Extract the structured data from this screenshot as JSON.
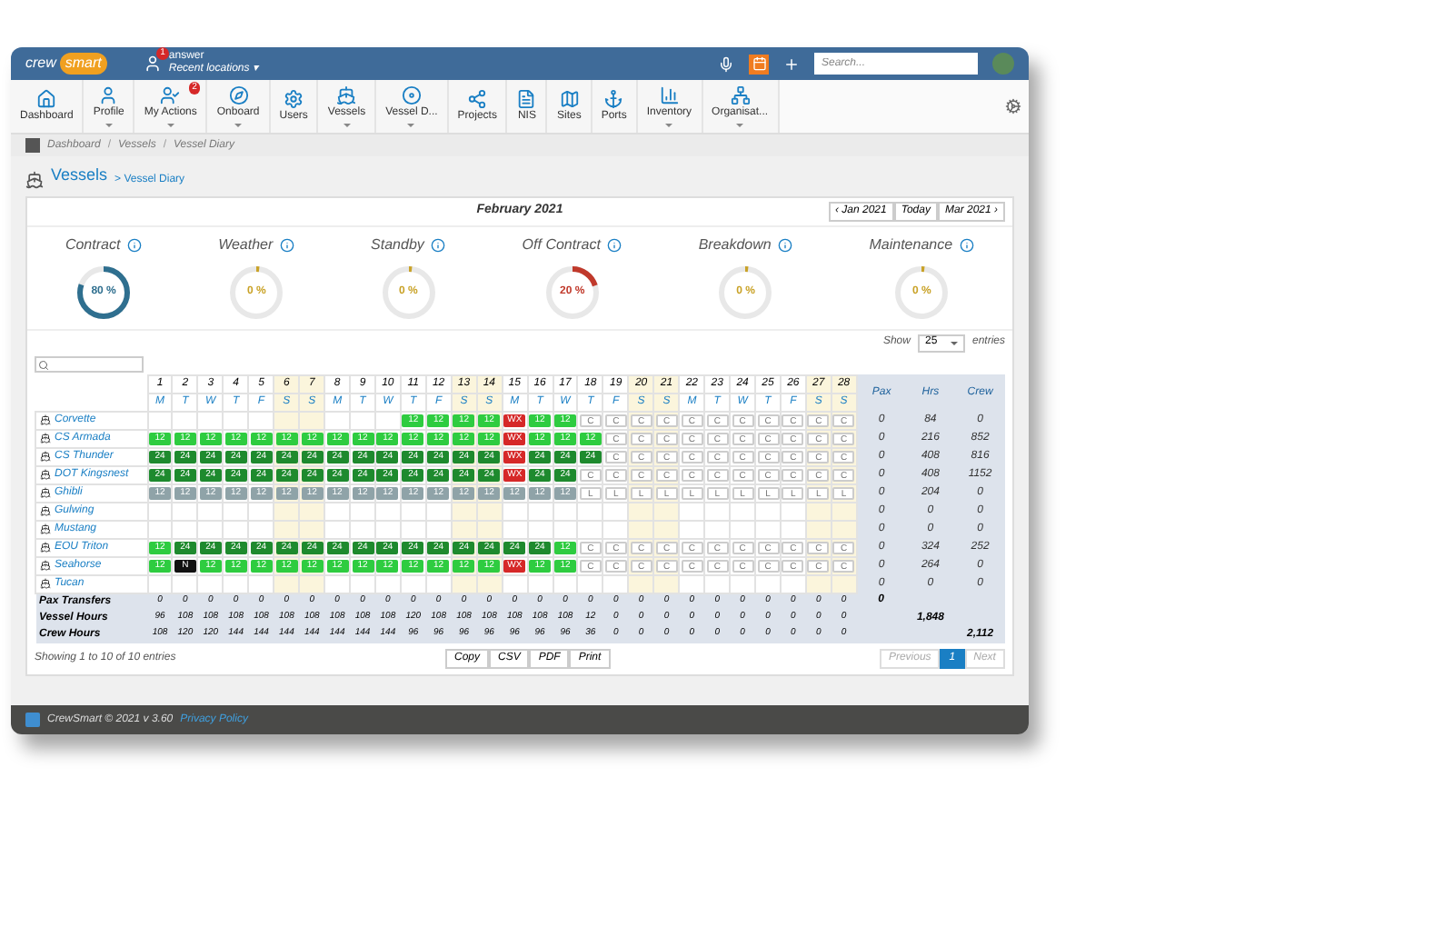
{
  "header": {
    "logo": [
      "crew",
      "smart"
    ],
    "user": "answer",
    "user_badge": "1",
    "recent": "Recent locations ▾",
    "search": {
      "placeholder": "Search..."
    }
  },
  "nav": [
    {
      "label": "Dashboard",
      "has_menu": false
    },
    {
      "label": "Profile",
      "has_menu": true
    },
    {
      "label": "My Actions",
      "has_menu": true,
      "badge": "2"
    },
    {
      "label": "Onboard",
      "has_menu": true
    },
    {
      "label": "Users",
      "has_menu": false
    },
    {
      "label": "Vessels",
      "has_menu": true
    },
    {
      "label": "Vessel D...",
      "has_menu": true
    },
    {
      "label": "Projects",
      "has_menu": false
    },
    {
      "label": "NIS",
      "has_menu": false
    },
    {
      "label": "Sites",
      "has_menu": false
    },
    {
      "label": "Ports",
      "has_menu": false
    },
    {
      "label": "Inventory",
      "has_menu": true
    },
    {
      "label": "Organisat...",
      "has_menu": true
    }
  ],
  "breadcrumb": [
    {
      "kind": "link",
      "text": "Dashboard"
    },
    {
      "kind": "separator",
      "text": "/"
    },
    {
      "kind": "link",
      "text": "Vessels"
    },
    {
      "kind": "separator",
      "text": "/"
    },
    {
      "kind": "link",
      "text": "Vessel Diary"
    }
  ],
  "page_title": {
    "main": "Vessels",
    "sub": "> Vessel Diary"
  },
  "month": {
    "label": "February 2021",
    "prev": "‹ Jan 2021",
    "today": "Today",
    "next": "Mar 2021 ›"
  },
  "kpis": [
    {
      "label": "Contract",
      "reading": "80 %",
      "level": 0.8,
      "color": "#2f6f8f"
    },
    {
      "label": "Weather",
      "reading": "0 %",
      "level": 0.02,
      "color": "#c9a227"
    },
    {
      "label": "Standby",
      "reading": "0 %",
      "level": 0.02,
      "color": "#c9a227"
    },
    {
      "label": "Off Contract",
      "reading": "20 %",
      "level": 0.2,
      "color": "#c0392b"
    },
    {
      "label": "Breakdown",
      "reading": "0 %",
      "level": 0.02,
      "color": "#c9a227"
    },
    {
      "label": "Maintenance",
      "reading": "0 %",
      "level": 0.02,
      "color": "#c9a227"
    }
  ],
  "show": {
    "label": "Show",
    "value": "25",
    "suffix": "entries"
  },
  "table": {
    "days": [
      {
        "day": "1",
        "weekday": "M",
        "weekend": false
      },
      {
        "day": "2",
        "weekday": "T",
        "weekend": false
      },
      {
        "day": "3",
        "weekday": "W",
        "weekend": false
      },
      {
        "day": "4",
        "weekday": "T",
        "weekend": false
      },
      {
        "day": "5",
        "weekday": "F",
        "weekend": false
      },
      {
        "day": "6",
        "weekday": "S",
        "weekend": true
      },
      {
        "day": "7",
        "weekday": "S",
        "weekend": true
      },
      {
        "day": "8",
        "weekday": "M",
        "weekend": false
      },
      {
        "day": "9",
        "weekday": "T",
        "weekend": false
      },
      {
        "day": "10",
        "weekday": "W",
        "weekend": false
      },
      {
        "day": "11",
        "weekday": "T",
        "weekend": false
      },
      {
        "day": "12",
        "weekday": "F",
        "weekend": false
      },
      {
        "day": "13",
        "weekday": "S",
        "weekend": true
      },
      {
        "day": "14",
        "weekday": "S",
        "weekend": true
      },
      {
        "day": "15",
        "weekday": "M",
        "weekend": false
      },
      {
        "day": "16",
        "weekday": "T",
        "weekend": false
      },
      {
        "day": "17",
        "weekday": "W",
        "weekend": false
      },
      {
        "day": "18",
        "weekday": "T",
        "weekend": false
      },
      {
        "day": "19",
        "weekday": "F",
        "weekend": false
      },
      {
        "day": "20",
        "weekday": "S",
        "weekend": true
      },
      {
        "day": "21",
        "weekday": "S",
        "weekend": true
      },
      {
        "day": "22",
        "weekday": "M",
        "weekend": false
      },
      {
        "day": "23",
        "weekday": "T",
        "weekend": false
      },
      {
        "day": "24",
        "weekday": "W",
        "weekend": false
      },
      {
        "day": "25",
        "weekday": "T",
        "weekend": false
      },
      {
        "day": "26",
        "weekday": "F",
        "weekend": false
      },
      {
        "day": "27",
        "weekday": "S",
        "weekend": true
      },
      {
        "day": "28",
        "weekday": "S",
        "weekend": true
      }
    ],
    "total_columns": [
      "Pax",
      "Hrs",
      "Crew"
    ],
    "rows": [
      {
        "vessel": "Corvette",
        "totals": [
          "0",
          "84",
          "0"
        ],
        "cells": [
          {
            "kind": "empty"
          },
          {
            "kind": "empty"
          },
          {
            "kind": "empty"
          },
          {
            "kind": "empty"
          },
          {
            "kind": "empty"
          },
          {
            "kind": "empty"
          },
          {
            "kind": "empty"
          },
          {
            "kind": "empty"
          },
          {
            "kind": "empty"
          },
          {
            "kind": "empty"
          },
          {
            "kind": "light",
            "text": "12"
          },
          {
            "kind": "light",
            "text": "12"
          },
          {
            "kind": "light",
            "text": "12"
          },
          {
            "kind": "light",
            "text": "12"
          },
          {
            "kind": "red",
            "text": "WX"
          },
          {
            "kind": "light",
            "text": "12"
          },
          {
            "kind": "light",
            "text": "12"
          },
          {
            "kind": "contract",
            "text": "C"
          },
          {
            "kind": "contract",
            "text": "C"
          },
          {
            "kind": "contract",
            "text": "C"
          },
          {
            "kind": "contract",
            "text": "C"
          },
          {
            "kind": "contract",
            "text": "C"
          },
          {
            "kind": "contract",
            "text": "C"
          },
          {
            "kind": "contract",
            "text": "C"
          },
          {
            "kind": "contract",
            "text": "C"
          },
          {
            "kind": "contract",
            "text": "C"
          },
          {
            "kind": "contract",
            "text": "C"
          },
          {
            "kind": "contract",
            "text": "C"
          }
        ]
      },
      {
        "vessel": "CS Armada",
        "totals": [
          "0",
          "216",
          "852"
        ],
        "cells": [
          {
            "kind": "light",
            "text": "12"
          },
          {
            "kind": "light",
            "text": "12"
          },
          {
            "kind": "light",
            "text": "12"
          },
          {
            "kind": "light",
            "text": "12"
          },
          {
            "kind": "light",
            "text": "12"
          },
          {
            "kind": "light",
            "text": "12"
          },
          {
            "kind": "light",
            "text": "12"
          },
          {
            "kind": "light",
            "text": "12"
          },
          {
            "kind": "light",
            "text": "12"
          },
          {
            "kind": "light",
            "text": "12"
          },
          {
            "kind": "light",
            "text": "12"
          },
          {
            "kind": "light",
            "text": "12"
          },
          {
            "kind": "light",
            "text": "12"
          },
          {
            "kind": "light",
            "text": "12"
          },
          {
            "kind": "red",
            "text": "WX"
          },
          {
            "kind": "light",
            "text": "12"
          },
          {
            "kind": "light",
            "text": "12"
          },
          {
            "kind": "light",
            "text": "12"
          },
          {
            "kind": "contract",
            "text": "C"
          },
          {
            "kind": "contract",
            "text": "C"
          },
          {
            "kind": "contract",
            "text": "C"
          },
          {
            "kind": "contract",
            "text": "C"
          },
          {
            "kind": "contract",
            "text": "C"
          },
          {
            "kind": "contract",
            "text": "C"
          },
          {
            "kind": "contract",
            "text": "C"
          },
          {
            "kind": "contract",
            "text": "C"
          },
          {
            "kind": "contract",
            "text": "C"
          },
          {
            "kind": "contract",
            "text": "C"
          }
        ]
      },
      {
        "vessel": "CS Thunder",
        "totals": [
          "0",
          "408",
          "816"
        ],
        "cells": [
          {
            "kind": "dark",
            "text": "24"
          },
          {
            "kind": "dark",
            "text": "24"
          },
          {
            "kind": "dark",
            "text": "24"
          },
          {
            "kind": "dark",
            "text": "24"
          },
          {
            "kind": "dark",
            "text": "24"
          },
          {
            "kind": "dark",
            "text": "24"
          },
          {
            "kind": "dark",
            "text": "24"
          },
          {
            "kind": "dark",
            "text": "24"
          },
          {
            "kind": "dark",
            "text": "24"
          },
          {
            "kind": "dark",
            "text": "24"
          },
          {
            "kind": "dark",
            "text": "24"
          },
          {
            "kind": "dark",
            "text": "24"
          },
          {
            "kind": "dark",
            "text": "24"
          },
          {
            "kind": "dark",
            "text": "24"
          },
          {
            "kind": "red",
            "text": "WX"
          },
          {
            "kind": "dark",
            "text": "24"
          },
          {
            "kind": "dark",
            "text": "24"
          },
          {
            "kind": "dark",
            "text": "24"
          },
          {
            "kind": "contract",
            "text": "C"
          },
          {
            "kind": "contract",
            "text": "C"
          },
          {
            "kind": "contract",
            "text": "C"
          },
          {
            "kind": "contract",
            "text": "C"
          },
          {
            "kind": "contract",
            "text": "C"
          },
          {
            "kind": "contract",
            "text": "C"
          },
          {
            "kind": "contract",
            "text": "C"
          },
          {
            "kind": "contract",
            "text": "C"
          },
          {
            "kind": "contract",
            "text": "C"
          },
          {
            "kind": "contract",
            "text": "C"
          }
        ]
      },
      {
        "vessel": "DOT Kingsnest",
        "totals": [
          "0",
          "408",
          "1152"
        ],
        "cells": [
          {
            "kind": "dark",
            "text": "24"
          },
          {
            "kind": "dark",
            "text": "24"
          },
          {
            "kind": "dark",
            "text": "24"
          },
          {
            "kind": "dark",
            "text": "24"
          },
          {
            "kind": "dark",
            "text": "24"
          },
          {
            "kind": "dark",
            "text": "24"
          },
          {
            "kind": "dark",
            "text": "24"
          },
          {
            "kind": "dark",
            "text": "24"
          },
          {
            "kind": "dark",
            "text": "24"
          },
          {
            "kind": "dark",
            "text": "24"
          },
          {
            "kind": "dark",
            "text": "24"
          },
          {
            "kind": "dark",
            "text": "24"
          },
          {
            "kind": "dark",
            "text": "24"
          },
          {
            "kind": "dark",
            "text": "24"
          },
          {
            "kind": "red",
            "text": "WX"
          },
          {
            "kind": "dark",
            "text": "24"
          },
          {
            "kind": "dark",
            "text": "24"
          },
          {
            "kind": "contract",
            "text": "C"
          },
          {
            "kind": "contract",
            "text": "C"
          },
          {
            "kind": "contract",
            "text": "C"
          },
          {
            "kind": "contract",
            "text": "C"
          },
          {
            "kind": "contract",
            "text": "C"
          },
          {
            "kind": "contract",
            "text": "C"
          },
          {
            "kind": "contract",
            "text": "C"
          },
          {
            "kind": "contract",
            "text": "C"
          },
          {
            "kind": "contract",
            "text": "C"
          },
          {
            "kind": "contract",
            "text": "C"
          },
          {
            "kind": "contract",
            "text": "C"
          }
        ]
      },
      {
        "vessel": "Ghibli",
        "totals": [
          "0",
          "204",
          "0"
        ],
        "cells": [
          {
            "kind": "grey",
            "text": "12"
          },
          {
            "kind": "grey",
            "text": "12"
          },
          {
            "kind": "grey",
            "text": "12"
          },
          {
            "kind": "grey",
            "text": "12"
          },
          {
            "kind": "grey",
            "text": "12"
          },
          {
            "kind": "grey",
            "text": "12"
          },
          {
            "kind": "grey",
            "text": "12"
          },
          {
            "kind": "grey",
            "text": "12"
          },
          {
            "kind": "grey",
            "text": "12"
          },
          {
            "kind": "grey",
            "text": "12"
          },
          {
            "kind": "grey",
            "text": "12"
          },
          {
            "kind": "grey",
            "text": "12"
          },
          {
            "kind": "grey",
            "text": "12"
          },
          {
            "kind": "grey",
            "text": "12"
          },
          {
            "kind": "grey",
            "text": "12"
          },
          {
            "kind": "grey",
            "text": "12"
          },
          {
            "kind": "grey",
            "text": "12"
          },
          {
            "kind": "contract",
            "text": "L"
          },
          {
            "kind": "contract",
            "text": "L"
          },
          {
            "kind": "contract",
            "text": "L"
          },
          {
            "kind": "contract",
            "text": "L"
          },
          {
            "kind": "contract",
            "text": "L"
          },
          {
            "kind": "contract",
            "text": "L"
          },
          {
            "kind": "contract",
            "text": "L"
          },
          {
            "kind": "contract",
            "text": "L"
          },
          {
            "kind": "contract",
            "text": "L"
          },
          {
            "kind": "contract",
            "text": "L"
          },
          {
            "kind": "contract",
            "text": "L"
          }
        ]
      },
      {
        "vessel": "Gulwing",
        "totals": [
          "0",
          "0",
          "0"
        ],
        "cells": [
          {
            "kind": "empty"
          },
          {
            "kind": "empty"
          },
          {
            "kind": "empty"
          },
          {
            "kind": "empty"
          },
          {
            "kind": "empty"
          },
          {
            "kind": "empty"
          },
          {
            "kind": "empty"
          },
          {
            "kind": "empty"
          },
          {
            "kind": "empty"
          },
          {
            "kind": "empty"
          },
          {
            "kind": "empty"
          },
          {
            "kind": "empty"
          },
          {
            "kind": "empty"
          },
          {
            "kind": "empty"
          },
          {
            "kind": "empty"
          },
          {
            "kind": "empty"
          },
          {
            "kind": "empty"
          },
          {
            "kind": "empty"
          },
          {
            "kind": "empty"
          },
          {
            "kind": "empty"
          },
          {
            "kind": "empty"
          },
          {
            "kind": "empty"
          },
          {
            "kind": "empty"
          },
          {
            "kind": "empty"
          },
          {
            "kind": "empty"
          },
          {
            "kind": "empty"
          },
          {
            "kind": "empty"
          },
          {
            "kind": "empty"
          }
        ]
      },
      {
        "vessel": "Mustang",
        "totals": [
          "0",
          "0",
          "0"
        ],
        "cells": [
          {
            "kind": "empty"
          },
          {
            "kind": "empty"
          },
          {
            "kind": "empty"
          },
          {
            "kind": "empty"
          },
          {
            "kind": "empty"
          },
          {
            "kind": "empty"
          },
          {
            "kind": "empty"
          },
          {
            "kind": "empty"
          },
          {
            "kind": "empty"
          },
          {
            "kind": "empty"
          },
          {
            "kind": "empty"
          },
          {
            "kind": "empty"
          },
          {
            "kind": "empty"
          },
          {
            "kind": "empty"
          },
          {
            "kind": "empty"
          },
          {
            "kind": "empty"
          },
          {
            "kind": "empty"
          },
          {
            "kind": "empty"
          },
          {
            "kind": "empty"
          },
          {
            "kind": "empty"
          },
          {
            "kind": "empty"
          },
          {
            "kind": "empty"
          },
          {
            "kind": "empty"
          },
          {
            "kind": "empty"
          },
          {
            "kind": "empty"
          },
          {
            "kind": "empty"
          },
          {
            "kind": "empty"
          },
          {
            "kind": "empty"
          }
        ]
      },
      {
        "vessel": "EOU Triton",
        "totals": [
          "0",
          "324",
          "252"
        ],
        "cells": [
          {
            "kind": "light",
            "text": "12"
          },
          {
            "kind": "dark",
            "text": "24"
          },
          {
            "kind": "dark",
            "text": "24"
          },
          {
            "kind": "dark",
            "text": "24"
          },
          {
            "kind": "dark",
            "text": "24"
          },
          {
            "kind": "dark",
            "text": "24"
          },
          {
            "kind": "dark",
            "text": "24"
          },
          {
            "kind": "dark",
            "text": "24"
          },
          {
            "kind": "dark",
            "text": "24"
          },
          {
            "kind": "dark",
            "text": "24"
          },
          {
            "kind": "dark",
            "text": "24"
          },
          {
            "kind": "dark",
            "text": "24"
          },
          {
            "kind": "dark",
            "text": "24"
          },
          {
            "kind": "dark",
            "text": "24"
          },
          {
            "kind": "dark",
            "text": "24"
          },
          {
            "kind": "dark",
            "text": "24"
          },
          {
            "kind": "light",
            "text": "12"
          },
          {
            "kind": "contract",
            "text": "C"
          },
          {
            "kind": "contract",
            "text": "C"
          },
          {
            "kind": "contract",
            "text": "C"
          },
          {
            "kind": "contract",
            "text": "C"
          },
          {
            "kind": "contract",
            "text": "C"
          },
          {
            "kind": "contract",
            "text": "C"
          },
          {
            "kind": "contract",
            "text": "C"
          },
          {
            "kind": "contract",
            "text": "C"
          },
          {
            "kind": "contract",
            "text": "C"
          },
          {
            "kind": "contract",
            "text": "C"
          },
          {
            "kind": "contract",
            "text": "C"
          }
        ]
      },
      {
        "vessel": "Seahorse",
        "totals": [
          "0",
          "264",
          "0"
        ],
        "cells": [
          {
            "kind": "light",
            "text": "12"
          },
          {
            "kind": "black",
            "text": "N"
          },
          {
            "kind": "light",
            "text": "12"
          },
          {
            "kind": "light",
            "text": "12"
          },
          {
            "kind": "light",
            "text": "12"
          },
          {
            "kind": "light",
            "text": "12"
          },
          {
            "kind": "light",
            "text": "12"
          },
          {
            "kind": "light",
            "text": "12"
          },
          {
            "kind": "light",
            "text": "12"
          },
          {
            "kind": "light",
            "text": "12"
          },
          {
            "kind": "light",
            "text": "12"
          },
          {
            "kind": "light",
            "text": "12"
          },
          {
            "kind": "light",
            "text": "12"
          },
          {
            "kind": "light",
            "text": "12"
          },
          {
            "kind": "red",
            "text": "WX"
          },
          {
            "kind": "light",
            "text": "12"
          },
          {
            "kind": "light",
            "text": "12"
          },
          {
            "kind": "contract",
            "text": "C"
          },
          {
            "kind": "contract",
            "text": "C"
          },
          {
            "kind": "contract",
            "text": "C"
          },
          {
            "kind": "contract",
            "text": "C"
          },
          {
            "kind": "contract",
            "text": "C"
          },
          {
            "kind": "contract",
            "text": "C"
          },
          {
            "kind": "contract",
            "text": "C"
          },
          {
            "kind": "contract",
            "text": "C"
          },
          {
            "kind": "contract",
            "text": "C"
          },
          {
            "kind": "contract",
            "text": "C"
          },
          {
            "kind": "contract",
            "text": "C"
          }
        ]
      },
      {
        "vessel": "Tucan",
        "totals": [
          "0",
          "0",
          "0"
        ],
        "cells": [
          {
            "kind": "empty"
          },
          {
            "kind": "empty"
          },
          {
            "kind": "empty"
          },
          {
            "kind": "empty"
          },
          {
            "kind": "empty"
          },
          {
            "kind": "empty"
          },
          {
            "kind": "empty"
          },
          {
            "kind": "empty"
          },
          {
            "kind": "empty"
          },
          {
            "kind": "empty"
          },
          {
            "kind": "empty"
          },
          {
            "kind": "empty"
          },
          {
            "kind": "empty"
          },
          {
            "kind": "empty"
          },
          {
            "kind": "empty"
          },
          {
            "kind": "empty"
          },
          {
            "kind": "empty"
          },
          {
            "kind": "empty"
          },
          {
            "kind": "empty"
          },
          {
            "kind": "empty"
          },
          {
            "kind": "empty"
          },
          {
            "kind": "empty"
          },
          {
            "kind": "empty"
          },
          {
            "kind": "empty"
          },
          {
            "kind": "empty"
          },
          {
            "kind": "empty"
          },
          {
            "kind": "empty"
          },
          {
            "kind": "empty"
          }
        ]
      }
    ],
    "summary_rows": [
      {
        "label": "Pax Transfers",
        "total": "0",
        "values": [
          "0",
          "0",
          "0",
          "0",
          "0",
          "0",
          "0",
          "0",
          "0",
          "0",
          "0",
          "0",
          "0",
          "0",
          "0",
          "0",
          "0",
          "0",
          "0",
          "0",
          "0",
          "0",
          "0",
          "0",
          "0",
          "0",
          "0",
          "0"
        ]
      },
      {
        "label": "Vessel Hours",
        "total": "1,848",
        "values": [
          "96",
          "108",
          "108",
          "108",
          "108",
          "108",
          "108",
          "108",
          "108",
          "108",
          "120",
          "108",
          "108",
          "108",
          "108",
          "108",
          "108",
          "12",
          "0",
          "0",
          "0",
          "0",
          "0",
          "0",
          "0",
          "0",
          "0",
          "0"
        ]
      },
      {
        "label": "Crew Hours",
        "total": "2,112",
        "values": [
          "108",
          "120",
          "120",
          "144",
          "144",
          "144",
          "144",
          "144",
          "144",
          "144",
          "96",
          "96",
          "96",
          "96",
          "96",
          "96",
          "96",
          "36",
          "0",
          "0",
          "0",
          "0",
          "0",
          "0",
          "0",
          "0",
          "0",
          "0"
        ]
      }
    ]
  },
  "info": "Showing 1 to 10 of 10 entries",
  "export_buttons": [
    "Copy",
    "CSV",
    "PDF",
    "Print"
  ],
  "pagination": [
    {
      "label": "Previous",
      "selected": false
    },
    {
      "label": "1",
      "selected": true
    },
    {
      "label": "Next",
      "selected": false
    }
  ],
  "footer": {
    "text": "CrewSmart © 2021 v 3.60",
    "link": "Privacy Policy"
  }
}
